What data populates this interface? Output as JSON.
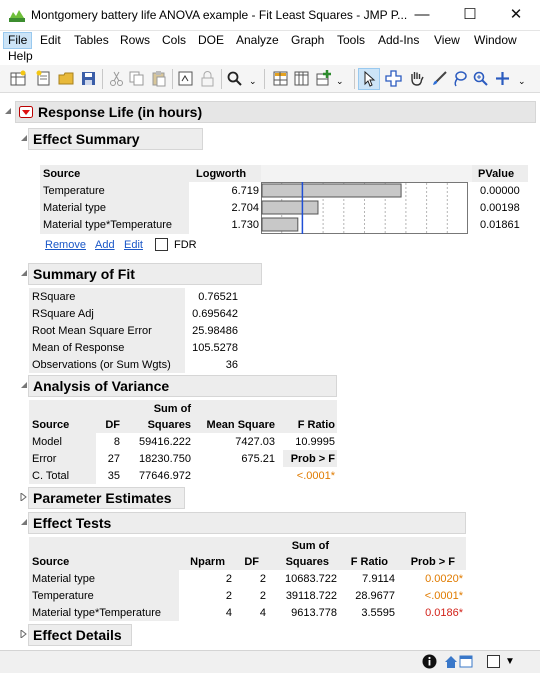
{
  "window": {
    "title": "Montgomery battery life ANOVA example - Fit Least Squares - JMP P...",
    "minimize_glyph": "—",
    "maximize_glyph": "☐",
    "close_glyph": "✕"
  },
  "menu": [
    "File",
    "Edit",
    "Tables",
    "Rows",
    "Cols",
    "DOE",
    "Analyze",
    "Graph",
    "Tools",
    "Add-Ins",
    "View",
    "Window",
    "Help"
  ],
  "toolbar_icons": [
    "new-data-table-icon",
    "new-script-icon",
    "open-icon",
    "save-icon",
    "cut-icon",
    "copy-icon",
    "paste-icon",
    "show-properties-icon",
    "lock-icon",
    "search-icon",
    "data-grid-icon",
    "columns-icon",
    "add-rows-icon",
    "arrow-tool-icon",
    "crosshair-icon",
    "hand-tool-icon",
    "brush-icon",
    "lasso-icon",
    "zoom-icon",
    "annotate-icon"
  ],
  "report": {
    "response_title": "Response Life (in hours)",
    "effect_summary": {
      "title": "Effect Summary",
      "headers": {
        "source": "Source",
        "logworth": "Logworth",
        "pvalue": "PValue"
      },
      "rows": [
        {
          "source": "Temperature",
          "logworth": "6.719",
          "pvalue": "0.00000"
        },
        {
          "source": "Material type",
          "logworth": "2.704",
          "pvalue": "0.00198"
        },
        {
          "source": "Material type*Temperature",
          "logworth": "1.730",
          "pvalue": "0.01861"
        }
      ],
      "logworth_values": [
        6.719,
        2.704,
        1.73
      ],
      "logworth_axis_max": 10,
      "reference_logworth": 2,
      "actions": {
        "remove": "Remove",
        "add": "Add",
        "edit": "Edit",
        "fdr": "FDR"
      }
    },
    "summary_of_fit": {
      "title": "Summary of Fit",
      "rows": [
        {
          "label": "RSquare",
          "value": "0.76521"
        },
        {
          "label": "RSquare Adj",
          "value": "0.695642"
        },
        {
          "label": "Root Mean Square Error",
          "value": "25.98486"
        },
        {
          "label": "Mean of Response",
          "value": "105.5278"
        },
        {
          "label": "Observations (or Sum Wgts)",
          "value": "36"
        }
      ]
    },
    "anova": {
      "title": "Analysis of Variance",
      "headers": {
        "source": "Source",
        "df": "DF",
        "ss_top": "Sum of",
        "ss_bottom": "Squares",
        "ms": "Mean Square",
        "f": "F Ratio"
      },
      "rows": [
        {
          "source": "Model",
          "df": "8",
          "ss": "59416.222",
          "ms": "7427.03",
          "f": "10.9995"
        },
        {
          "source": "Error",
          "df": "27",
          "ss": "18230.750",
          "ms": "675.21",
          "f": "Prob > F"
        },
        {
          "source": "C. Total",
          "df": "35",
          "ss": "77646.972",
          "ms": "",
          "f": "<.0001*"
        }
      ]
    },
    "parameter_estimates": {
      "title": "Parameter Estimates"
    },
    "effect_tests": {
      "title": "Effect Tests",
      "headers": {
        "source": "Source",
        "nparm": "Nparm",
        "df": "DF",
        "ss_top": "Sum of",
        "ss_bottom": "Squares",
        "f": "F Ratio",
        "p": "Prob > F"
      },
      "rows": [
        {
          "source": "Material type",
          "nparm": "2",
          "df": "2",
          "ss": "10683.722",
          "f": "7.9114",
          "p": "0.0020*"
        },
        {
          "source": "Temperature",
          "nparm": "2",
          "df": "2",
          "ss": "39118.722",
          "f": "28.9677",
          "p": "<.0001*"
        },
        {
          "source": "Material type*Temperature",
          "nparm": "4",
          "df": "4",
          "ss": "9613.778",
          "f": "3.5595",
          "p": "0.0186*"
        }
      ]
    },
    "effect_details": {
      "title": "Effect Details"
    }
  },
  "colors": {
    "accent": "#1a57c7",
    "significant_orange": "#e07b00",
    "significant_red": "#d2221a",
    "bar_fill": "#c8c8c8",
    "ref_line": "#1f4fd6"
  }
}
